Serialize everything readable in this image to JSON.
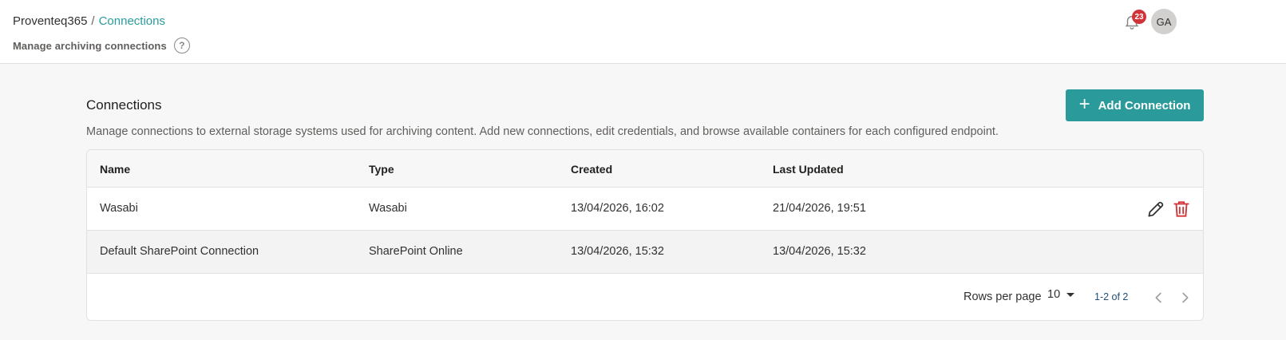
{
  "breadcrumb": {
    "root": "Proventeq365",
    "separator": "/",
    "current": "Connections"
  },
  "header": {
    "subtitle": "Manage archiving connections",
    "help": "?",
    "notification_count": "23",
    "avatar_initials": "GA"
  },
  "section": {
    "title": "Connections",
    "description": "Manage connections to external storage systems used for archiving content. Add new connections, edit credentials, and browse available containers for each configured endpoint."
  },
  "add_button": {
    "label": "Add Connection",
    "icon": "plus-icon"
  },
  "table": {
    "columns": [
      "Name",
      "Type",
      "Created",
      "Last Updated"
    ],
    "rows": [
      {
        "name": "Wasabi",
        "type": "Wasabi",
        "created": "13/04/2026, 16:02",
        "updated": "21/04/2026, 19:51"
      },
      {
        "name": "Default SharePoint Connection",
        "type": "SharePoint Online",
        "created": "13/04/2026, 15:32",
        "updated": "13/04/2026, 15:32"
      }
    ]
  },
  "pagination": {
    "rows_label": "Rows per page",
    "rows_value": "10",
    "range": "1-2 of 2"
  },
  "colors": {
    "accent": "#2b9a9a",
    "danger": "#d13438",
    "text": "#323130"
  }
}
